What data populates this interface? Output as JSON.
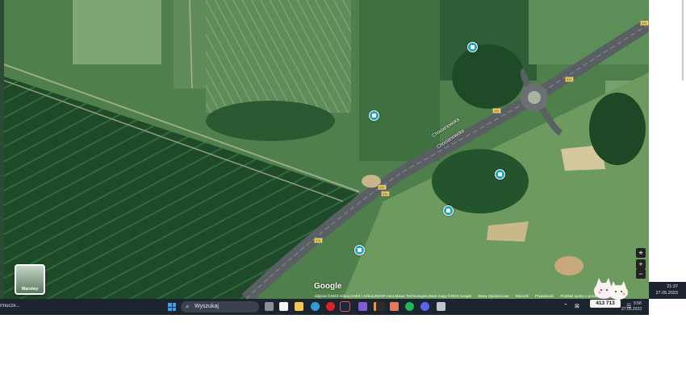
{
  "map": {
    "road_labels": [
      "Chocianowska",
      "Chocianowska"
    ],
    "route_badges": [
      "331",
      "331",
      "331",
      "331",
      "331",
      "331"
    ],
    "google_logo": "Google",
    "footer": {
      "attribution": "Zdjęcia ©2023 Airbus,CNES / Airbus,MGGP Aero,Maxar Technologies,Dane mapy ©2023 Google",
      "links": [
        "Stany Zjednoczone",
        "Warunki",
        "Prywatność",
        "Przekaż opinię o produkcie"
      ]
    },
    "layers_label": "Warstwy",
    "controls": {
      "locate_icon": "crosshair-icon",
      "zoom_in": "+",
      "zoom_out": "−"
    },
    "poi_icon": "place-marker-icon"
  },
  "taskbar": {
    "left_text": "rmucze...",
    "search_placeholder": "Wyszukaj",
    "apps": [
      "task-view",
      "store",
      "file-explorer",
      "edge",
      "opera",
      "steam",
      "discord-alt",
      "sublime",
      "photos",
      "spotify",
      "discord",
      "printer"
    ],
    "counter": "413 713",
    "time": "21:37",
    "date": "27.05.2023",
    "time_partial": "5:58",
    "date_partial": "27.05.2023"
  }
}
